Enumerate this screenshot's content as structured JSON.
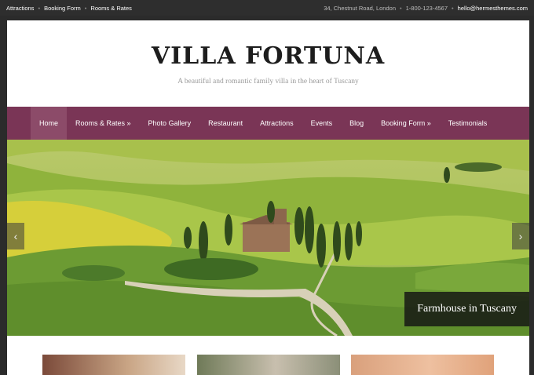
{
  "topbar": {
    "links": [
      "Attractions",
      "Booking Form",
      "Rooms & Rates"
    ],
    "address": "34, Chestnut Road, London",
    "phone": "1-800-123-4567",
    "email": "hello@hermesthemes.com"
  },
  "header": {
    "title": "VILLA FORTUNA",
    "tagline": "A beautiful and romantic family villa in the heart of Tuscany"
  },
  "nav": {
    "items": [
      "Home",
      "Rooms & Rates »",
      "Photo Gallery",
      "Restaurant",
      "Attractions",
      "Events",
      "Blog",
      "Booking Form »",
      "Testimonials"
    ],
    "active": "Home"
  },
  "slider": {
    "caption": "Farmhouse in Tuscany",
    "prev_icon": "chevron-left-icon",
    "next_icon": "chevron-right-icon"
  },
  "colors": {
    "nav_bg": "#7a3556",
    "nav_active": "#8c4b69",
    "topbar_bg": "#2e2e2e"
  }
}
